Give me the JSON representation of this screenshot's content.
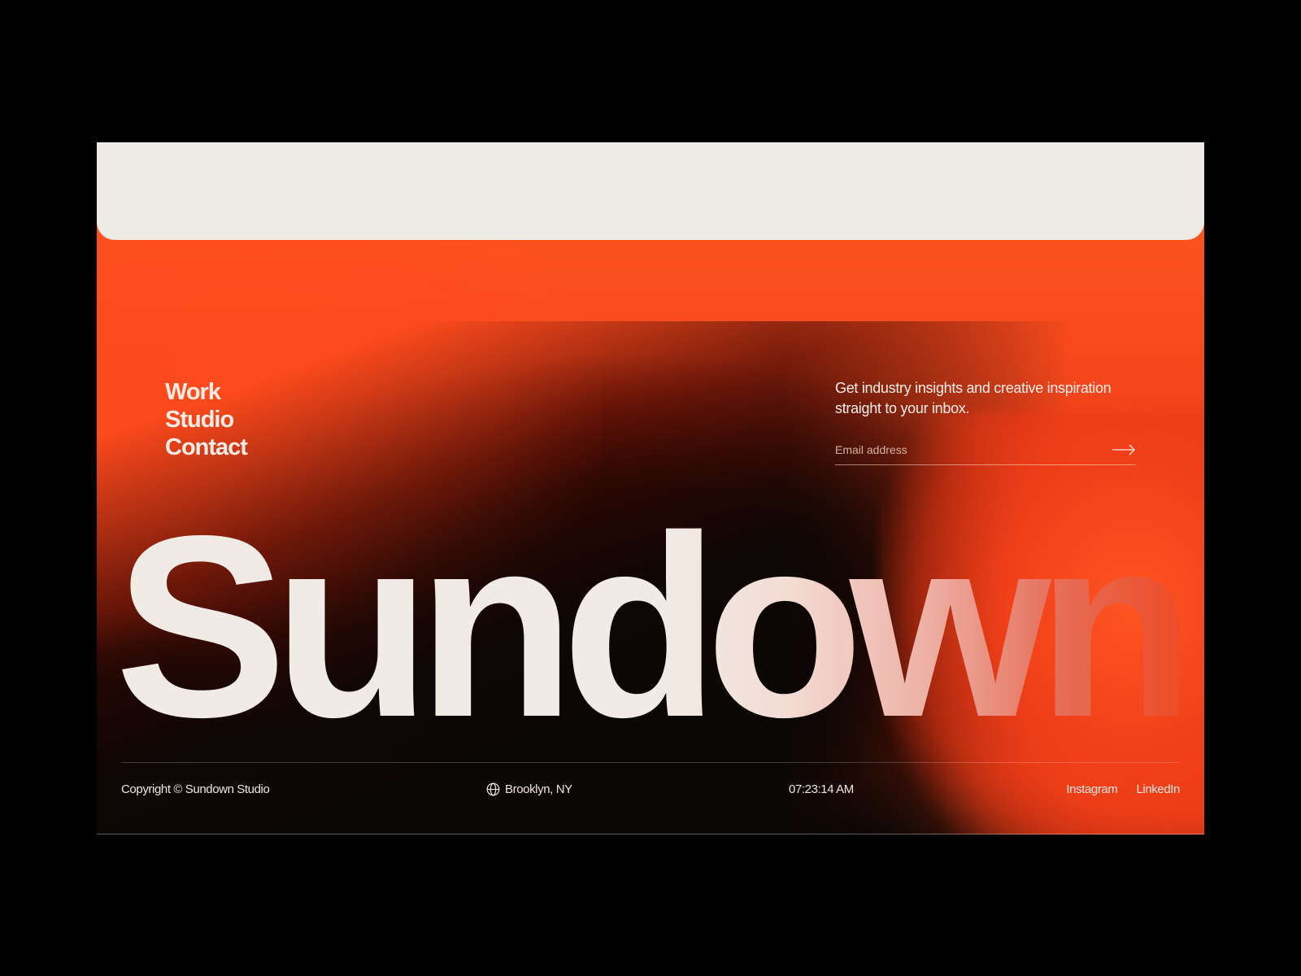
{
  "nav": {
    "items": [
      {
        "label": "Work"
      },
      {
        "label": "Studio"
      },
      {
        "label": "Contact"
      }
    ]
  },
  "newsletter": {
    "text": "Get industry insights and creative inspiration straight to your inbox.",
    "email_placeholder": "Email address",
    "submit_icon": "arrow-right-icon"
  },
  "hero": {
    "wordmark": "Sundown"
  },
  "footer": {
    "copyright": "Copyright © Sundown Studio",
    "location_icon": "globe-icon",
    "location": "Brooklyn, NY",
    "time": "07:23:14 AM",
    "social": {
      "instagram": "Instagram",
      "linkedin": "LinkedIn"
    }
  },
  "colors": {
    "accent_orange": "#f8491d",
    "dark": "#0b0705",
    "cream": "#efebe5"
  }
}
